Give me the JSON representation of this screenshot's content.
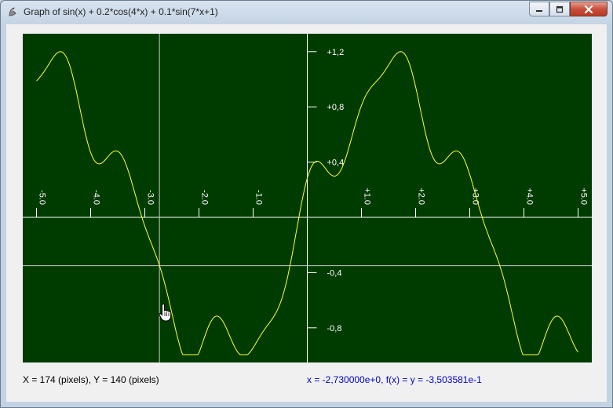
{
  "window": {
    "title": "Graph of sin(x) + 0.2*cos(4*x) + 0.1*sin(7*x+1)",
    "controls": [
      "minimize-icon",
      "maximize-icon",
      "close-icon"
    ]
  },
  "status": {
    "pixel_readout": "X = 174 (pixels), Y = 140 (pixels)",
    "value_readout": "x = -2,730000e+0, f(x) = y = -3,503581e-1"
  },
  "colors": {
    "plot_background": "#003c00",
    "curve": "#ffff33",
    "axes": "#ffffff",
    "crosshair": "#c8c8c8",
    "readout_text": "#0000cc"
  },
  "chart_data": {
    "type": "line",
    "function": "sin(x) + 0.2*cos(4*x) + 0.1*sin(7*x+1)",
    "xlim": [
      -5.0,
      5.0
    ],
    "ylim": [
      -0.8,
      1.2
    ],
    "x_tick_labels": [
      "-5.0",
      "-4.0",
      "-3.0",
      "-2.0",
      "-1.0",
      "+1.0",
      "+2.0",
      "+3.0",
      "+4.0",
      "+5.0"
    ],
    "x_ticks": [
      -5,
      -4,
      -3,
      -2,
      -1,
      1,
      2,
      3,
      4,
      5
    ],
    "y_tick_labels": [
      "+1,2",
      "+0,8",
      "+0,4",
      "-0,4",
      "-0,8"
    ],
    "y_ticks": [
      1.2,
      0.8,
      0.4,
      -0.4,
      -0.8
    ],
    "crosshair": {
      "x": -2.73,
      "y": -0.3503581
    },
    "grid": false
  }
}
